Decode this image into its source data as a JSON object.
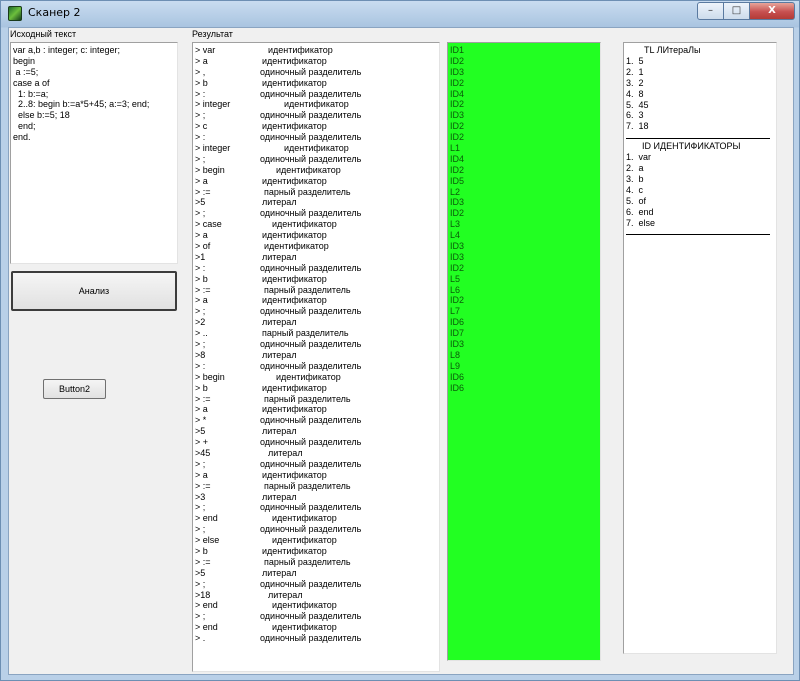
{
  "window": {
    "title": "Сканер 2",
    "controls": {
      "minimize": "–",
      "maximize": "□",
      "close": "X"
    }
  },
  "source_panel": {
    "label": "Исходный текст",
    "lines": [
      "var a,b : integer; c: integer;",
      "begin",
      " a :=5;",
      "case a of",
      "  1: b:=a;",
      "  2..8: begin b:=a*5+45; a:=3; end;",
      "  else b:=5; 18",
      "  end;",
      "end."
    ]
  },
  "buttons": {
    "analyze": "Анализ",
    "button2": "Button2"
  },
  "result_panel": {
    "label": "Результат",
    "rows": [
      {
        "token": "> var",
        "kind": "идентификатор",
        "off": 74
      },
      {
        "token": "> a",
        "kind": "идентификатор",
        "off": 68
      },
      {
        "token": "> ,",
        "kind": "одиночный разделитель",
        "off": 66
      },
      {
        "token": "> b",
        "kind": "идентификатор",
        "off": 68
      },
      {
        "token": "> :",
        "kind": "одиночный разделитель",
        "off": 66
      },
      {
        "token": "> integer",
        "kind": "идентификатор",
        "off": 90
      },
      {
        "token": "> ;",
        "kind": "одиночный разделитель",
        "off": 66
      },
      {
        "token": "> c",
        "kind": "идентификатор",
        "off": 68
      },
      {
        "token": "> :",
        "kind": "одиночный разделитель",
        "off": 66
      },
      {
        "token": "> integer",
        "kind": "идентификатор",
        "off": 90
      },
      {
        "token": "> ;",
        "kind": "одиночный разделитель",
        "off": 66
      },
      {
        "token": "> begin",
        "kind": "идентификатор",
        "off": 82
      },
      {
        "token": "> a",
        "kind": "идентификатор",
        "off": 68
      },
      {
        "token": "> :=",
        "kind": "парный разделитель",
        "off": 70
      },
      {
        "token": ">5",
        "kind": "литерал",
        "off": 68
      },
      {
        "token": "> ;",
        "kind": "одиночный разделитель",
        "off": 66
      },
      {
        "token": "> case",
        "kind": "идентификатор",
        "off": 78
      },
      {
        "token": "> a",
        "kind": "идентификатор",
        "off": 68
      },
      {
        "token": "> of",
        "kind": "идентификатор",
        "off": 70
      },
      {
        "token": ">1",
        "kind": "литерал",
        "off": 68
      },
      {
        "token": "> :",
        "kind": "одиночный разделитель",
        "off": 66
      },
      {
        "token": "> b",
        "kind": "идентификатор",
        "off": 68
      },
      {
        "token": "> :=",
        "kind": "парный разделитель",
        "off": 70
      },
      {
        "token": "> a",
        "kind": "идентификатор",
        "off": 68
      },
      {
        "token": "> ;",
        "kind": "одиночный разделитель",
        "off": 66
      },
      {
        "token": ">2",
        "kind": "литерал",
        "off": 68
      },
      {
        "token": "> ..",
        "kind": "парный разделитель",
        "off": 68
      },
      {
        "token": "> ;",
        "kind": "одиночный разделитель",
        "off": 66
      },
      {
        "token": ">8",
        "kind": "литерал",
        "off": 68
      },
      {
        "token": "> :",
        "kind": "одиночный разделитель",
        "off": 66
      },
      {
        "token": "> begin",
        "kind": "идентификатор",
        "off": 82
      },
      {
        "token": "> b",
        "kind": "идентификатор",
        "off": 68
      },
      {
        "token": "> :=",
        "kind": "парный разделитель",
        "off": 70
      },
      {
        "token": "> a",
        "kind": "идентификатор",
        "off": 68
      },
      {
        "token": "> *",
        "kind": "одиночный разделитель",
        "off": 66
      },
      {
        "token": ">5",
        "kind": "литерал",
        "off": 68
      },
      {
        "token": "> +",
        "kind": "одиночный разделитель",
        "off": 66
      },
      {
        "token": ">45",
        "kind": "литерал",
        "off": 74
      },
      {
        "token": "> ;",
        "kind": "одиночный разделитель",
        "off": 66
      },
      {
        "token": "> a",
        "kind": "идентификатор",
        "off": 68
      },
      {
        "token": "> :=",
        "kind": "парный разделитель",
        "off": 70
      },
      {
        "token": ">3",
        "kind": "литерал",
        "off": 68
      },
      {
        "token": "> ;",
        "kind": "одиночный разделитель",
        "off": 66
      },
      {
        "token": "> end",
        "kind": "идентификатор",
        "off": 78
      },
      {
        "token": "> ;",
        "kind": "одиночный разделитель",
        "off": 66
      },
      {
        "token": "> else",
        "kind": "идентификатор",
        "off": 78
      },
      {
        "token": "> b",
        "kind": "идентификатор",
        "off": 68
      },
      {
        "token": "> :=",
        "kind": "парный разделитель",
        "off": 70
      },
      {
        "token": ">5",
        "kind": "литерал",
        "off": 68
      },
      {
        "token": "> ;",
        "kind": "одиночный разделитель",
        "off": 66
      },
      {
        "token": ">18",
        "kind": "литерал",
        "off": 74
      },
      {
        "token": "> end",
        "kind": "идентификатор",
        "off": 78
      },
      {
        "token": "> ;",
        "kind": "одиночный разделитель",
        "off": 66
      },
      {
        "token": "> end",
        "kind": "идентификатор",
        "off": 78
      },
      {
        "token": "> .",
        "kind": "одиночный разделитель",
        "off": 66
      }
    ]
  },
  "codes_panel": {
    "background": "#22ff22",
    "lines": [
      "ID1",
      "ID2",
      "ID3",
      "ID2",
      "ID4",
      "ID2",
      "ID3",
      "ID2",
      "ID2",
      "L1",
      "ID4",
      "ID2",
      "ID5",
      "L2",
      "ID3",
      "ID2",
      "L3",
      "L4",
      "ID3",
      "ID3",
      "ID2",
      "L5",
      "L6",
      "ID2",
      "L7",
      "ID6",
      "ID7",
      "ID3",
      "L8",
      "L9",
      "ID6",
      "ID6"
    ]
  },
  "tables_panel": {
    "literals_title": "TL ЛИтераЛы",
    "literals": [
      "1.  5",
      "2.  1",
      "3.  2",
      "4.  8",
      "5.  45",
      "6.  3",
      "7.  18"
    ],
    "identifiers_title": "ID ИДЕНТИФИКАТОРЫ",
    "identifiers": [
      "1.  var",
      "2.  a",
      "3.  b",
      "4.  c",
      "5.  of",
      "6.  end",
      "7.  else"
    ]
  }
}
